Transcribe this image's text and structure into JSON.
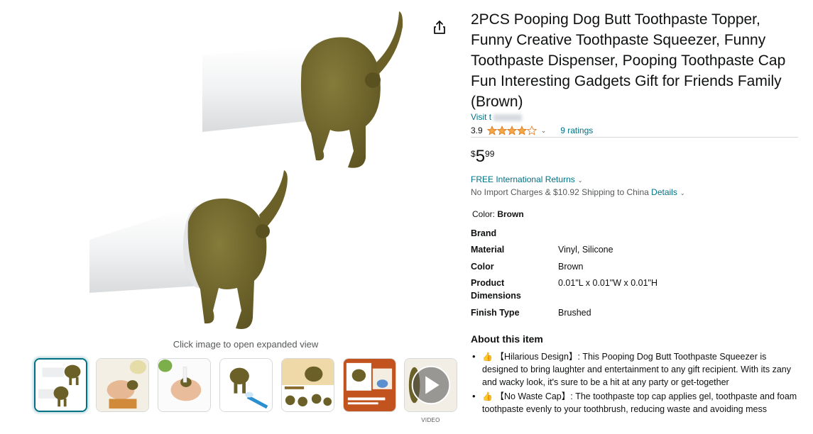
{
  "gallery": {
    "share_icon": "share-icon",
    "expand_hint": "Click image to open expanded view",
    "video_label": "VIDEO",
    "thumbnail_count": 7,
    "selected_thumbnail": 1
  },
  "product": {
    "title": "2PCS Pooping Dog Butt Toothpaste Topper, Funny Creative Toothpaste Squeezer, Funny Toothpaste Dispenser, Pooping Toothpaste Cap Fun Interesting Gadgets Gift for Friends Family (Brown)",
    "visit_store": "Visit t",
    "rating": "3.9",
    "rating_value": 3.9,
    "ratings_count": "9 ratings",
    "price": {
      "symbol": "$",
      "whole": "5",
      "fraction": "99"
    },
    "returns": "FREE International Returns",
    "shipping": "No Import Charges & $10.92 Shipping to China ",
    "shipping_details": "Details",
    "color_label": "Color: ",
    "color_value": "Brown",
    "specs": [
      {
        "key": "Brand",
        "value": ""
      },
      {
        "key": "Material",
        "value": "Vinyl, Silicone"
      },
      {
        "key": "Color",
        "value": "Brown"
      },
      {
        "key": "Product Dimensions",
        "value": "0.01\"L x 0.01\"W x 0.01\"H"
      },
      {
        "key": "Finish Type",
        "value": "Brushed"
      }
    ],
    "about_title": "About this item",
    "bullets": [
      {
        "emoji": "👍",
        "text": "【Hilarious Design】: This Pooping Dog Butt Toothpaste Squeezer is designed to bring laughter and entertainment to any gift recipient. With its zany and wacky look, it's sure to be a hit at any party or get-together"
      },
      {
        "emoji": "👍",
        "text": "【No Waste Cap】: The toothpaste top cap applies gel, toothpaste and foam toothpaste evenly to your toothbrush, reducing waste and avoiding mess"
      }
    ]
  },
  "colors": {
    "link": "#007185",
    "star": "#f3a847",
    "brown": "#6b6128",
    "text": "#0f1111"
  }
}
